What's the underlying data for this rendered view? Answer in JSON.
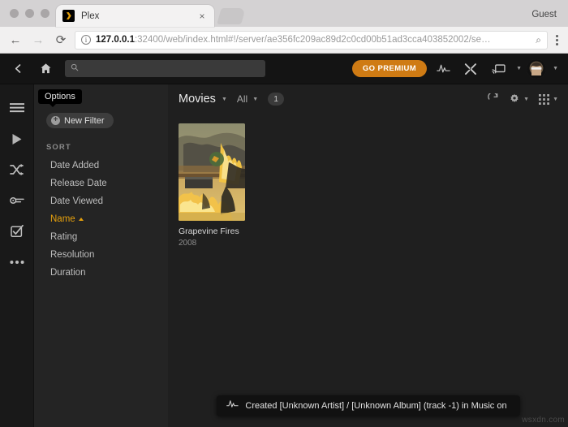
{
  "browser": {
    "tab": {
      "title": "Plex",
      "favicon": "plex-logo-icon",
      "close_label": "×"
    },
    "profile_label": "Guest",
    "nav": {
      "back": "←",
      "forward": "→",
      "reload": "⟳"
    },
    "omnibox": {
      "info_glyph": "i",
      "url_host": "127.0.0.1",
      "url_rest": ":32400/web/index.html#!/server/ae356fc209ac89d2c0cd00b51ad3cca403852002/se…",
      "zoom_glyph": "⌕"
    }
  },
  "plex": {
    "topbar": {
      "back_icon": "chevron-left-icon",
      "home_icon": "home-icon",
      "search_placeholder": "",
      "search_value": "",
      "premium_label": "GO PREMIUM",
      "activity_icon": "activity-pulse-icon",
      "tools_icon": "wrench-screwdriver-icon",
      "cast_icon": "cast-icon",
      "avatar_icon": "user-avatar"
    },
    "rail": [
      {
        "name": "menu",
        "icon": "hamburger-menu-icon"
      },
      {
        "name": "play",
        "icon": "play-icon"
      },
      {
        "name": "shuffle",
        "icon": "shuffle-icon"
      },
      {
        "name": "discover",
        "icon": "discover-key-icon"
      },
      {
        "name": "playlist",
        "icon": "checkbox-list-icon"
      },
      {
        "name": "more",
        "icon": "ellipsis-icon"
      }
    ],
    "sidebar": {
      "tooltip": "Options",
      "new_filter_label": "New Filter",
      "new_filter_icon": "plus-circle-icon",
      "sort_header": "SORT",
      "sort_items": [
        {
          "label": "Date Added",
          "active": false
        },
        {
          "label": "Release Date",
          "active": false
        },
        {
          "label": "Date Viewed",
          "active": false
        },
        {
          "label": "Name",
          "active": true
        },
        {
          "label": "Rating",
          "active": false
        },
        {
          "label": "Resolution",
          "active": false
        },
        {
          "label": "Duration",
          "active": false
        }
      ],
      "active_sort_direction": "ascending"
    },
    "content": {
      "library_title": "Movies",
      "filter_label": "All",
      "item_count": "1",
      "refresh_icon": "refresh-icon",
      "settings_icon": "gear-icon",
      "view_icon": "grid-view-icon",
      "items": [
        {
          "title": "Grapevine Fires",
          "year": "2008"
        }
      ]
    },
    "toast": {
      "icon": "activity-pulse-icon",
      "message": "Created [Unknown Artist] / [Unknown Album] (track -1) in Music on"
    }
  },
  "watermark": "wsxdn.com",
  "colors": {
    "plex_gold": "#e5a00d",
    "premium_orange": "#cf7b14",
    "app_bg": "#1f1f1f",
    "sidebar_bg": "#242424",
    "topbar_bg": "#141414"
  }
}
